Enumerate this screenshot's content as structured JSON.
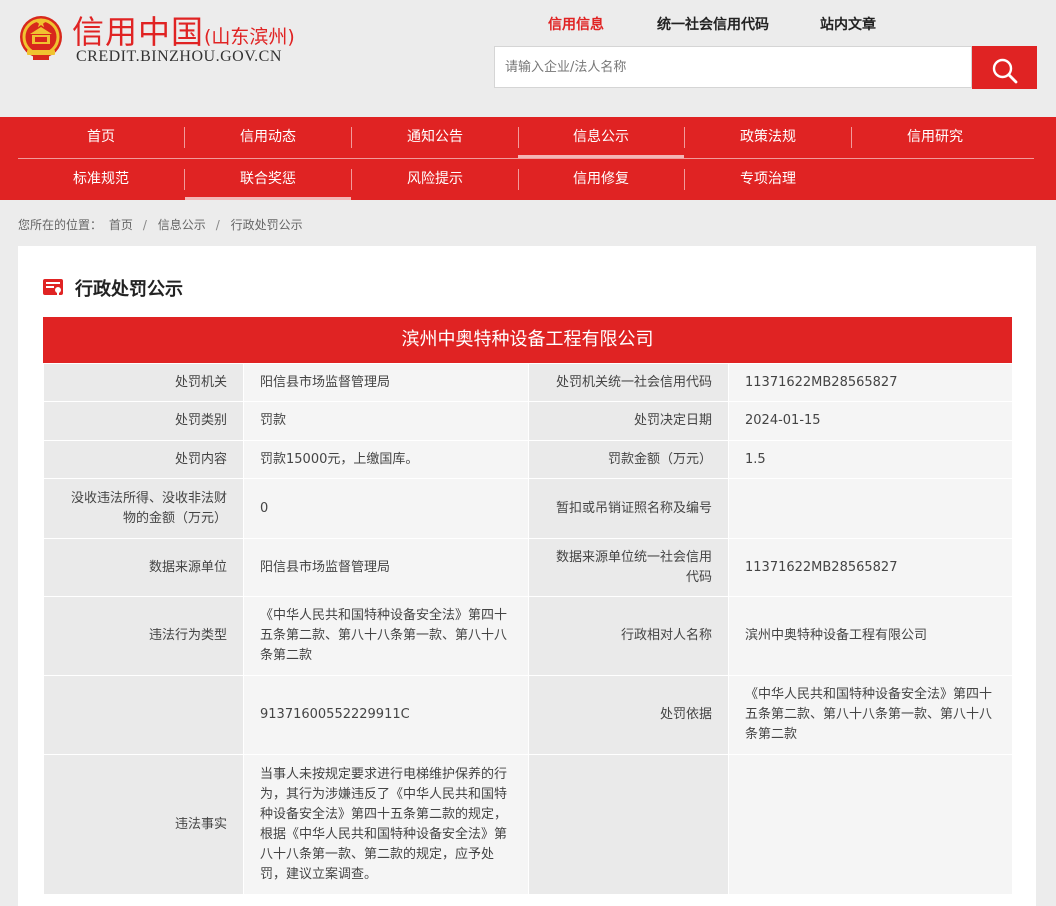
{
  "header": {
    "logo_title": "信用中国",
    "logo_region": "(山东滨州)",
    "logo_domain": "CREDIT.BINZHOU.GOV.CN",
    "search_tabs": [
      "信用信息",
      "统一社会信用代码",
      "站内文章"
    ],
    "search_placeholder": "请输入企业/法人名称"
  },
  "nav": {
    "row1": [
      "首页",
      "信用动态",
      "通知公告",
      "信息公示",
      "政策法规",
      "信用研究"
    ],
    "row2": [
      "标准规范",
      "联合奖惩",
      "风险提示",
      "信用修复",
      "专项治理"
    ]
  },
  "breadcrumb": {
    "prefix": "您所在的位置：",
    "items": [
      "首页",
      "信息公示",
      "行政处罚公示"
    ]
  },
  "panel": {
    "title": "行政处罚公示",
    "company": "滨州中奥特种设备工程有限公司"
  },
  "table": {
    "rows": [
      [
        "处罚机关",
        "阳信县市场监督管理局",
        "处罚机关统一社会信用代码",
        "11371622MB28565827"
      ],
      [
        "处罚类别",
        "罚款",
        "处罚决定日期",
        "2024-01-15"
      ],
      [
        "处罚内容",
        "罚款15000元，上缴国库。",
        "罚款金额（万元）",
        "1.5"
      ],
      [
        "没收违法所得、没收非法财物的金额（万元）",
        "0",
        "暂扣或吊销证照名称及编号",
        ""
      ],
      [
        "数据来源单位",
        "阳信县市场监督管理局",
        "数据来源单位统一社会信用代码",
        "11371622MB28565827"
      ],
      [
        "违法行为类型",
        "《中华人民共和国特种设备安全法》第四十五条第二款、第八十八条第一款、第八十八条第二款",
        "行政相对人名称",
        "滨州中奥特种设备工程有限公司"
      ],
      [
        "",
        "91371600552229911C",
        "处罚依据",
        "《中华人民共和国特种设备安全法》第四十五条第二款、第八十八条第一款、第八十八条第二款"
      ],
      [
        "违法事实",
        "当事人未按规定要求进行电梯维护保养的行为，其行为涉嫌违反了《中华人民共和国特种设备安全法》第四十五条第二款的规定，根据《中华人民共和国特种设备安全法》第八十八条第一款、第二款的规定，应予处罚，建议立案调查。",
        "",
        ""
      ]
    ]
  },
  "colors": {
    "brand_red": "#e02323"
  },
  "icons": [
    "national-emblem-icon",
    "search-icon",
    "document-seal-icon"
  ]
}
